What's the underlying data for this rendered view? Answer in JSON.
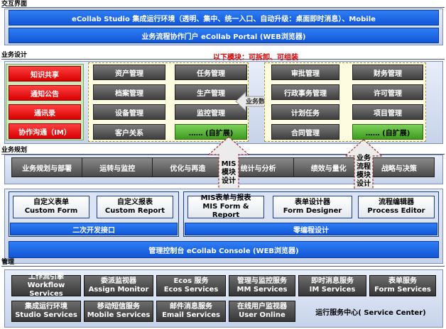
{
  "sections": {
    "interaction": "交互界面",
    "business_design": "业务设计",
    "business_planning": "业务规划",
    "management": "管理"
  },
  "interaction": {
    "studio_bar": "eCollab Studio 集成运行环境（透明、集中、统一入口、自动升级：桌面即时消息）、Mobile",
    "portal_bar": "业务流程协作门户 eCollab Portal (WEB浏览器)"
  },
  "business_design": {
    "note": "以下模块：可拆卸、可组装",
    "red_items": [
      "知识共享",
      "通知公告",
      "通讯录",
      "协作沟通（IM）"
    ],
    "mid_items": [
      [
        "资产管理",
        "任务管理"
      ],
      [
        "档案管理",
        "生产管理"
      ],
      [
        "设备管理",
        "监控管理"
      ],
      [
        "客户关系",
        "…… (自扩展)"
      ]
    ],
    "right_items": [
      [
        "审批管理",
        "财务管理"
      ],
      [
        "行政事务管理",
        "许可管理"
      ],
      [
        "计划任务",
        "项目管理"
      ],
      [
        "合同管理",
        "…… (自扩展)"
      ]
    ],
    "data_arrow": "业务数据"
  },
  "business_planning": {
    "items": [
      "业务规划与部署",
      "运转与监控",
      "优化与再造",
      "统计与分析",
      "绩效与量化",
      "战略与决策"
    ],
    "arrow_mis": "MIS\n模块\n设计",
    "arrow_flow": "业务\n流程\n模块\n设计"
  },
  "dev": {
    "custom_form_cn": "自定义表单",
    "custom_form_en": "Custom Form",
    "custom_report_cn": "自定义报表",
    "custom_report_en": "Custom Report",
    "secondary_bar": "二次开发接口",
    "mis_cn": "MIS表单与报表",
    "mis_en": "MIS Form & Report",
    "designer_cn": "表单设计器",
    "designer_en": "Form Designer",
    "editor_cn": "流程编辑器",
    "editor_en": "Process Editor",
    "zero_bar": "零编程设计",
    "console_bar": "管理控制台 eCollab Console (WEB浏览器)"
  },
  "services": {
    "row1": [
      {
        "cn": "工作流引擎",
        "en": "Workflow Services"
      },
      {
        "cn": "委派监视器",
        "en": "Assign Monitor"
      },
      {
        "cn": "Ecos 服务",
        "en": "Ecos Services"
      },
      {
        "cn": "管理与监控服务",
        "en": "MM Services"
      },
      {
        "cn": "即时消息服务",
        "en": "IM Services"
      },
      {
        "cn": "表单服务",
        "en": "Form Services"
      }
    ],
    "row2": [
      {
        "cn": "集成运行环境",
        "en": "Studio Services"
      },
      {
        "cn": "移动短信服务",
        "en": "Mobile Services"
      },
      {
        "cn": "邮件消息服务",
        "en": "Email Services"
      },
      {
        "cn": "在线用户监视器",
        "en": "User Online"
      }
    ],
    "center": "运行服务中心( Service Center)"
  }
}
